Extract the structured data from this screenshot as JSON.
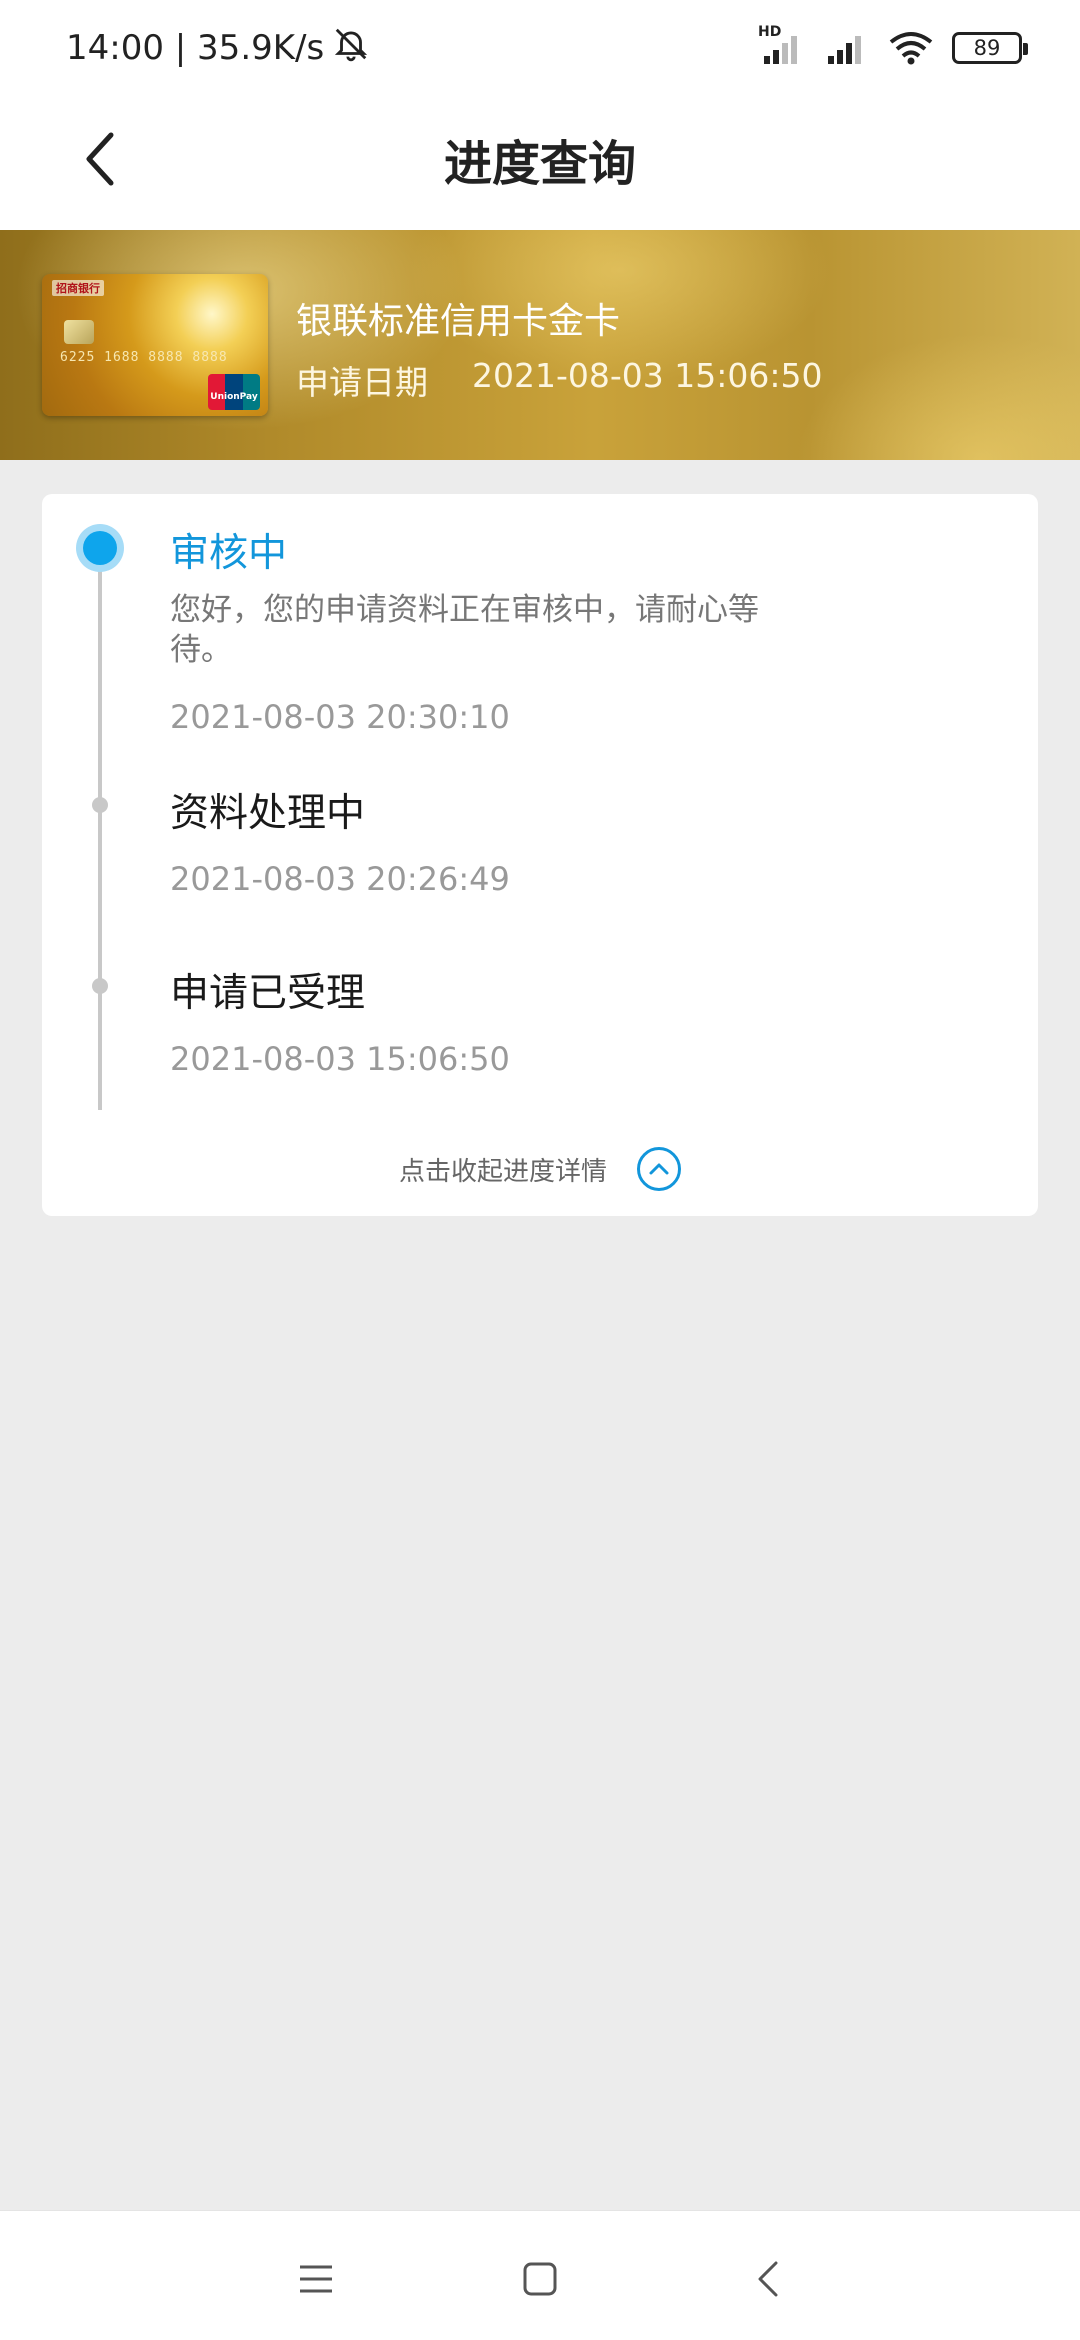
{
  "status_bar": {
    "time_speed": "14:00 | 35.9K/s",
    "signal_label": "HD",
    "battery": "89"
  },
  "header": {
    "title": "进度查询"
  },
  "card": {
    "name": "银联标准信用卡金卡",
    "apply_date_label": "申请日期",
    "apply_date_value": "2021-08-03 15:06:50",
    "bank_label": "招商银行",
    "number": "6225 1688 8888 8888",
    "network_label": "UnionPay"
  },
  "progress": {
    "steps": [
      {
        "title": "审核中",
        "description": "您好，您的申请资料正在审核中，请耐心等待。",
        "time": "2021-08-03 20:30:10",
        "active": true
      },
      {
        "title": "资料处理中",
        "time": "2021-08-03 20:26:49",
        "active": false
      },
      {
        "title": "申请已受理",
        "time": "2021-08-03 15:06:50",
        "active": false
      }
    ],
    "collapse_label": "点击收起进度详情"
  },
  "colors": {
    "accent": "#1296db",
    "background": "#ececec"
  }
}
